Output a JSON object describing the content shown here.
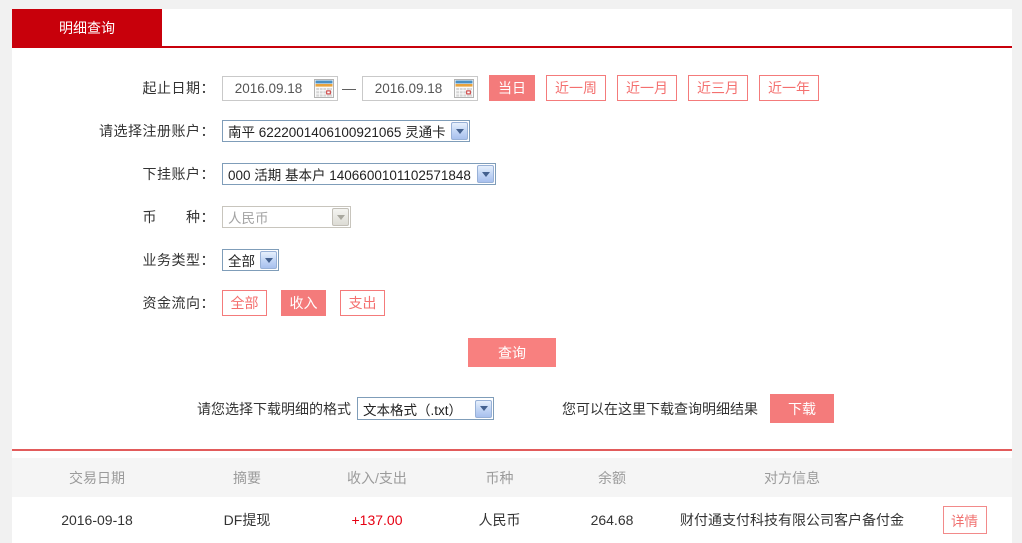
{
  "colors": {
    "tab_red": "#c8000b",
    "button_pink": "#f47b7b",
    "divider_red": "#e25b5b",
    "amount_red": "#e60012",
    "header_gray": "#9b9b9b"
  },
  "tab": {
    "label": "明细查询"
  },
  "form": {
    "date_row": {
      "label": "起止日期：",
      "start_date": "2016.09.18",
      "end_date": "2016.09.18",
      "separator": "—",
      "quick_buttons": [
        {
          "label": "当日",
          "active": true
        },
        {
          "label": "近一周",
          "active": false
        },
        {
          "label": "近一月",
          "active": false
        },
        {
          "label": "近三月",
          "active": false
        },
        {
          "label": "近一年",
          "active": false
        }
      ]
    },
    "register_account": {
      "label": "请选择注册账户：",
      "value": "南平 6222001406100921065 灵通卡"
    },
    "sub_account": {
      "label": "下挂账户：",
      "value": "000 活期 基本户 1406600101102571848"
    },
    "currency": {
      "label": "币　　种：",
      "value": "人民币",
      "disabled": true
    },
    "business_type": {
      "label": "业务类型：",
      "value": "全部"
    },
    "fund_flow": {
      "label": "资金流向：",
      "options": [
        {
          "label": "全部",
          "active": false
        },
        {
          "label": "收入",
          "active": true
        },
        {
          "label": "支出",
          "active": false
        }
      ]
    },
    "query_button": "查询"
  },
  "download": {
    "format_label": "请您选择下载明细的格式",
    "format_value": "文本格式（.txt）",
    "hint": "您可以在这里下载查询明细结果",
    "button": "下载"
  },
  "table": {
    "headers": {
      "date": "交易日期",
      "summary": "摘要",
      "amount": "收入/支出",
      "currency": "币种",
      "balance": "余额",
      "counterparty": "对方信息"
    },
    "rows": [
      {
        "date": "2016-09-18",
        "summary": "DF提现",
        "amount": "+137.00",
        "currency": "人民币",
        "balance": "264.68",
        "counterparty": "财付通支付科技有限公司客户备付金",
        "detail_button": "详情"
      }
    ]
  }
}
